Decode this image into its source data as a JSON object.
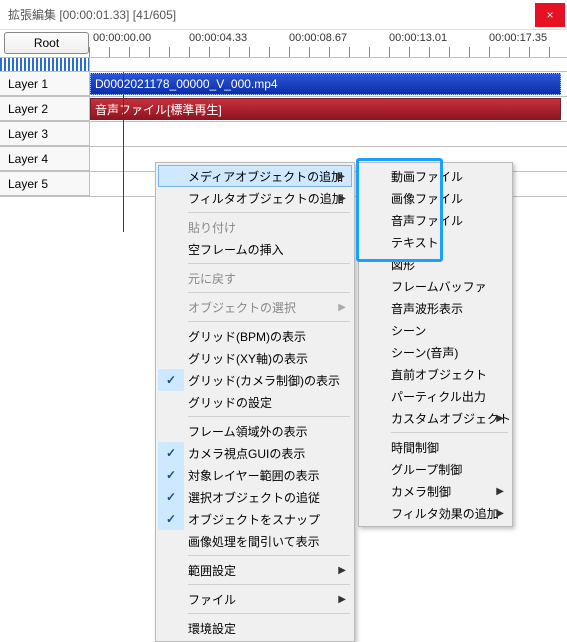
{
  "window": {
    "title": "拡張編集 [00:00:01.33] [41/605]",
    "close": "×"
  },
  "toolbar": {
    "root": "Root"
  },
  "ruler": {
    "t0": "00:00:00.00",
    "t1": "00:00:04.33",
    "t2": "00:00:08.67",
    "t3": "00:00:13.01",
    "t4": "00:00:17.35"
  },
  "layers": {
    "l1": "Layer 1",
    "l2": "Layer 2",
    "l3": "Layer 3",
    "l4": "Layer 4",
    "l5": "Layer 5"
  },
  "clips": {
    "video": "D0002021178_00000_V_000.mp4",
    "audio": "音声ファイル[標準再生]"
  },
  "menu1": {
    "add_media": "メディアオブジェクトの追加",
    "add_filter": "フィルタオブジェクトの追加",
    "paste": "貼り付け",
    "insert_empty": "空フレームの挿入",
    "undo": "元に戻す",
    "select_obj": "オブジェクトの選択",
    "grid_bpm": "グリッド(BPM)の表示",
    "grid_xy": "グリッド(XY軸)の表示",
    "grid_camera": "グリッド(カメラ制御)の表示",
    "grid_settings": "グリッドの設定",
    "frame_outside": "フレーム領域外の表示",
    "camera_gui": "カメラ視点GUIの表示",
    "layer_range": "対象レイヤー範囲の表示",
    "follow_sel": "選択オブジェクトの追従",
    "snap": "オブジェクトをスナップ",
    "thin_image": "画像処理を間引いて表示",
    "range_settings": "範囲設定",
    "file": "ファイル",
    "env": "環境設定"
  },
  "menu2": {
    "video_file": "動画ファイル",
    "image_file": "画像ファイル",
    "audio_file": "音声ファイル",
    "text": "テキスト",
    "shape_cut": "図形",
    "frame_buffer": "フレームバッファ",
    "wave_display": "音声波形表示",
    "scene": "シーン",
    "scene_audio": "シーン(音声)",
    "prev_obj": "直前オブジェクト",
    "particle": "パーティクル出力",
    "custom_obj": "カスタムオブジェクト",
    "time_ctrl": "時間制御",
    "group_ctrl": "グループ制御",
    "camera_ctrl": "カメラ制御",
    "add_filter_effect": "フィルタ効果の追加"
  }
}
